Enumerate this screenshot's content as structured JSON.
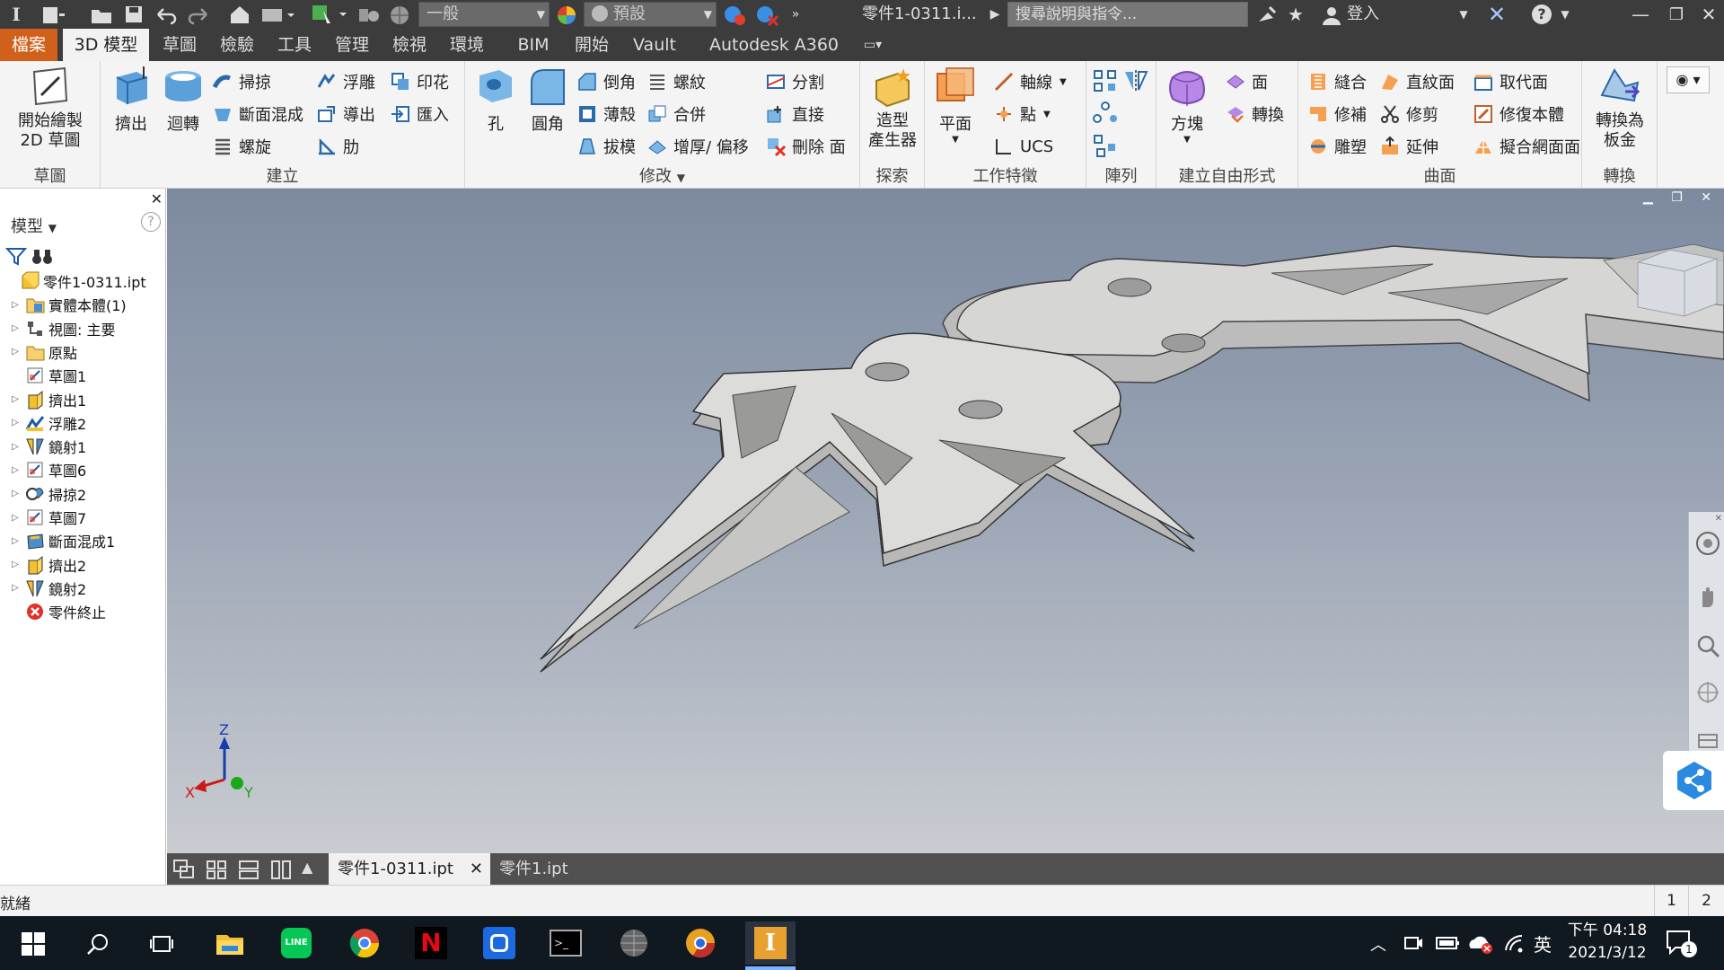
{
  "titlebar": {
    "style_combo": "一般",
    "appearance_combo": "預設",
    "document_title": "零件1-0311.i...",
    "search_placeholder": "搜尋說明與指令...",
    "sign_in": "登入"
  },
  "menu": {
    "tabs": [
      "檔案",
      "3D 模型",
      "草圖",
      "檢驗",
      "工具",
      "管理",
      "檢視",
      "環境",
      "BIM",
      "開始",
      "Vault",
      "Autodesk A360"
    ],
    "active": "3D 模型"
  },
  "ribbon": {
    "sketch": {
      "title": "草圖",
      "start_sketch": "開始繪製\n2D 草圖"
    },
    "create": {
      "title": "建立",
      "extrude": "擠出",
      "revolve": "迴轉",
      "sweep": "掃掠",
      "loft": "斷面混成",
      "coil": "螺旋",
      "emboss": "浮雕",
      "derive": "導出",
      "rib": "肋",
      "decal": "印花",
      "import": "匯入"
    },
    "modify": {
      "title": "修改",
      "hole": "孔",
      "fillet": "圓角",
      "chamfer": "倒角",
      "shell": "薄殼",
      "draft": "拔模",
      "thread": "螺紋",
      "combine": "合併",
      "thicken": "增厚/ 偏移",
      "split": "分割",
      "direct": "直接",
      "delete_face": "刪除 面"
    },
    "explore": {
      "title": "探索",
      "shape_generator": "造型\n產生器"
    },
    "work_features": {
      "title": "工作特徵",
      "plane": "平面",
      "axis": "軸線",
      "point": "點",
      "ucs": "UCS"
    },
    "pattern": {
      "title": "陣列"
    },
    "freeform": {
      "title": "建立自由形式",
      "box": "方塊",
      "face": "面",
      "convert": "轉換"
    },
    "surface": {
      "title": "曲面",
      "stitch": "縫合",
      "patch": "修補",
      "sculpt": "雕塑",
      "ruled_surface": "直紋面",
      "trim": "修剪",
      "extend": "延伸",
      "replace_face": "取代面",
      "repair_bodies": "修復本體",
      "fit_mesh_face": "擬合網面面"
    },
    "convert": {
      "title": "轉換",
      "to_sheet_metal": "轉換為\n板金"
    }
  },
  "browser": {
    "title": "模型",
    "items": [
      {
        "label": "零件1-0311.ipt",
        "indent": 0,
        "expander": "",
        "icon": "part-icon"
      },
      {
        "label": "實體本體(1)",
        "indent": 1,
        "expander": "▷",
        "icon": "solid-bodies-icon"
      },
      {
        "label": "視圖: 主要",
        "indent": 1,
        "expander": "▷",
        "icon": "view-rep-icon"
      },
      {
        "label": "原點",
        "indent": 1,
        "expander": "▷",
        "icon": "folder-icon"
      },
      {
        "label": "草圖1",
        "indent": 1,
        "expander": "",
        "icon": "sketch-icon"
      },
      {
        "label": "擠出1",
        "indent": 1,
        "expander": "▷",
        "icon": "extrude-icon"
      },
      {
        "label": "浮雕2",
        "indent": 1,
        "expander": "▷",
        "icon": "emboss-icon"
      },
      {
        "label": "鏡射1",
        "indent": 1,
        "expander": "▷",
        "icon": "mirror-icon"
      },
      {
        "label": "草圖6",
        "indent": 1,
        "expander": "▷",
        "icon": "sketch-icon"
      },
      {
        "label": "掃掠2",
        "indent": 1,
        "expander": "▷",
        "icon": "sweep-icon"
      },
      {
        "label": "草圖7",
        "indent": 1,
        "expander": "▷",
        "icon": "sketch-icon"
      },
      {
        "label": "斷面混成1",
        "indent": 1,
        "expander": "▷",
        "icon": "loft-icon"
      },
      {
        "label": "擠出2",
        "indent": 1,
        "expander": "▷",
        "icon": "extrude-icon"
      },
      {
        "label": "鏡射2",
        "indent": 1,
        "expander": "▷",
        "icon": "mirror-icon"
      },
      {
        "label": "零件終止",
        "indent": 1,
        "expander": "",
        "icon": "end-of-part-icon"
      }
    ]
  },
  "triad": {
    "x": "X",
    "y": "Y",
    "z": "Z"
  },
  "doc_tabs": {
    "active": "零件1-0311.ipt",
    "other": "零件1.ipt"
  },
  "status": {
    "text": "就緒",
    "count1": "1",
    "count2": "2"
  },
  "taskbar": {
    "time": "下午 04:18",
    "date": "2021/3/12",
    "ime": "英",
    "notification_count": "1"
  },
  "colors": {
    "accent_file_tab": "#d0601a",
    "dark_chrome": "#3c3c3c"
  }
}
